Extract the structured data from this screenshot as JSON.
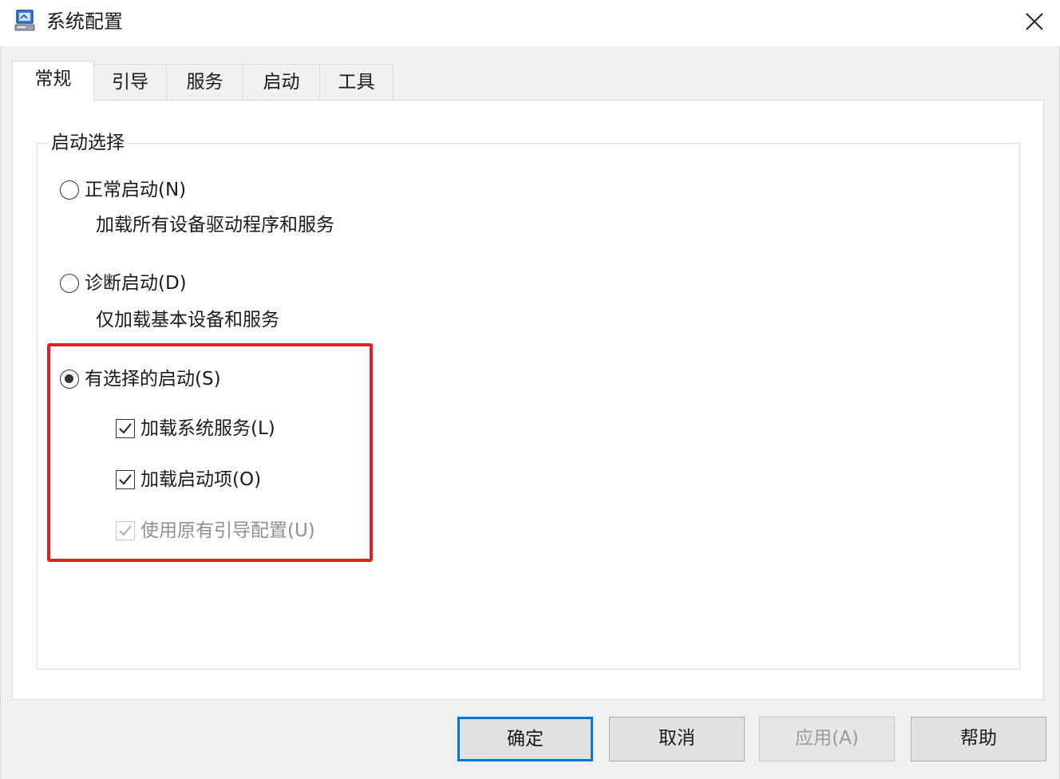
{
  "window": {
    "title": "系统配置",
    "icon": "msconfig-app-icon",
    "close_icon": "close-icon"
  },
  "tabs": [
    {
      "label": "常规",
      "active": true
    },
    {
      "label": "引导",
      "active": false
    },
    {
      "label": "服务",
      "active": false
    },
    {
      "label": "启动",
      "active": false
    },
    {
      "label": "工具",
      "active": false
    }
  ],
  "startup_selection": {
    "legend": "启动选择",
    "options": [
      {
        "label": "正常启动(N)",
        "description": "加载所有设备驱动程序和服务",
        "selected": false
      },
      {
        "label": "诊断启动(D)",
        "description": "仅加载基本设备和服务",
        "selected": false
      },
      {
        "label": "有选择的启动(S)",
        "selected": true
      }
    ],
    "selective_items": [
      {
        "label": "加载系统服务(L)",
        "checked": true,
        "enabled": true
      },
      {
        "label": "加载启动项(O)",
        "checked": true,
        "enabled": true
      },
      {
        "label": "使用原有引导配置(U)",
        "checked": true,
        "enabled": false
      }
    ]
  },
  "highlight_color": "#e02020",
  "accent_color": "#0078d7",
  "buttons": {
    "ok": "确定",
    "cancel": "取消",
    "apply": "应用(A)",
    "help": "帮助"
  }
}
